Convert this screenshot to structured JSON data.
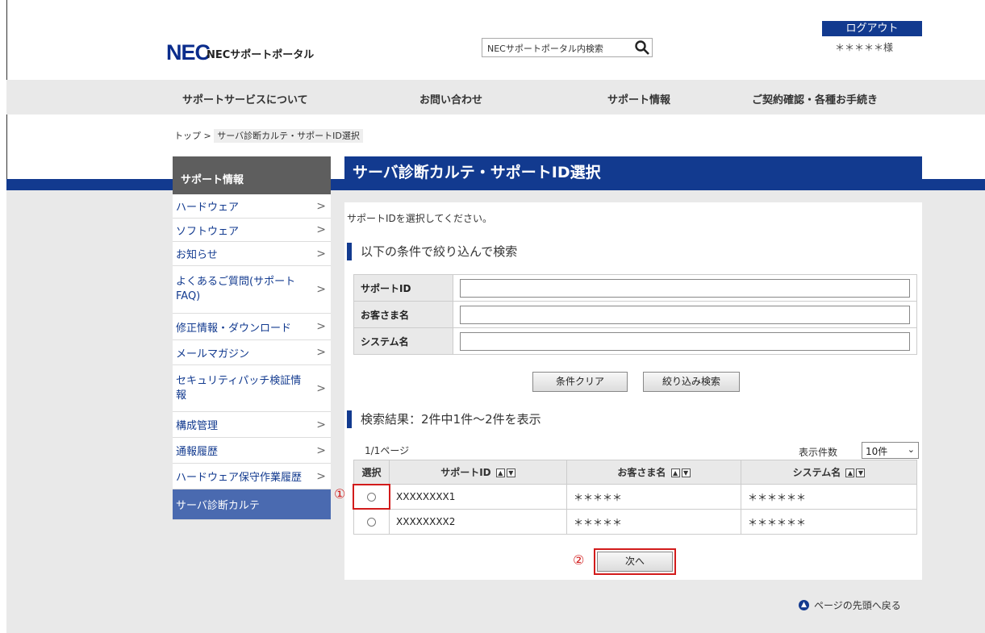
{
  "header": {
    "logo": "NEC",
    "portal_name": "NECサポートポータル",
    "search_placeholder": "NECサポートポータル内検索",
    "logout": "ログアウト",
    "username": "＊＊＊＊＊様"
  },
  "nav": {
    "items": [
      "サポートサービスについて",
      "お問い合わせ",
      "サポート情報",
      "ご契約確認・各種お手続き"
    ]
  },
  "breadcrumb": {
    "top": "トップ",
    "sep": ">",
    "current": "サーバ診断カルテ・サポートID選択"
  },
  "sidebar": {
    "heading": "サポート情報",
    "items": [
      {
        "label": "ハードウェア",
        "chevron": ">"
      },
      {
        "label": "ソフトウェア",
        "chevron": ">"
      },
      {
        "label": "お知らせ",
        "chevron": ">"
      },
      {
        "label": "よくあるご質問(サポートFAQ)",
        "chevron": ">"
      },
      {
        "label": "修正情報・ダウンロード",
        "chevron": ">"
      },
      {
        "label": "メールマガジン",
        "chevron": ">"
      },
      {
        "label": "セキュリティパッチ検証情報",
        "chevron": ">"
      },
      {
        "label": "構成管理",
        "chevron": ">"
      },
      {
        "label": "通報履歴",
        "chevron": ">"
      },
      {
        "label": "ハードウェア保守作業履歴",
        "chevron": ">"
      },
      {
        "label": "サーバ診断カルテ",
        "chevron": ""
      }
    ]
  },
  "main": {
    "title": "サーバ診断カルテ・サポートID選択",
    "intro": "サポートIDを選択してください。",
    "filter_heading": "以下の条件で絞り込んで検索",
    "filter_fields": [
      {
        "label": "サポートID",
        "value": ""
      },
      {
        "label": "お客さま名",
        "value": ""
      },
      {
        "label": "システム名",
        "value": ""
      }
    ],
    "clear_button": "条件クリア",
    "search_button": "絞り込み検索",
    "results_heading": "検索結果：2件中1件〜2件を表示",
    "page_info": "1/1ページ",
    "count_label": "表示件数",
    "count_value": "10件",
    "columns": [
      "選択",
      "サポートID",
      "お客さま名",
      "システム名"
    ],
    "sort_up": "▲",
    "sort_down": "▼",
    "rows": [
      {
        "id": "XXXXXXXX1",
        "customer": "＊＊＊＊＊",
        "system": "＊＊＊＊＊＊"
      },
      {
        "id": "XXXXXXXX2",
        "customer": "＊＊＊＊＊",
        "system": "＊＊＊＊＊＊"
      }
    ],
    "next_button": "次へ",
    "marker1": "①",
    "marker2": "②",
    "back_to_top": "ページの先頭へ戻る"
  },
  "colors": {
    "brand": "#123a8f",
    "highlight": "#d21b1b",
    "sidebar_head": "#5e5e5e"
  }
}
